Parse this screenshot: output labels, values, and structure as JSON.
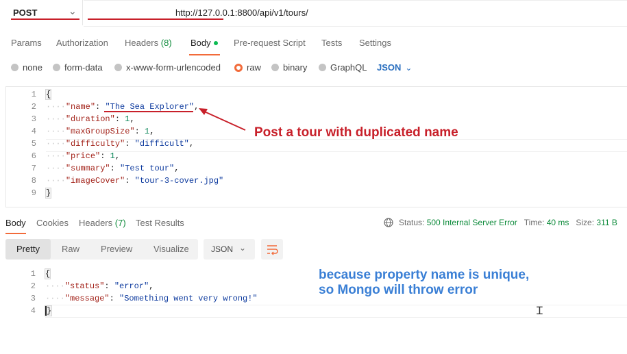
{
  "request": {
    "method": "POST",
    "url": "http://127.0.0.1:8800/api/v1/tours/"
  },
  "request_tabs": [
    {
      "label": "Params"
    },
    {
      "label": "Authorization"
    },
    {
      "label": "Headers",
      "count": "(8)"
    },
    {
      "label": "Body"
    },
    {
      "label": "Pre-request Script"
    },
    {
      "label": "Tests"
    },
    {
      "label": "Settings"
    }
  ],
  "body_types": {
    "none": "none",
    "form_data": "form-data",
    "urlencoded": "x-www-form-urlencoded",
    "raw": "raw",
    "binary": "binary",
    "graphql": "GraphQL",
    "format": "JSON",
    "selected": "raw"
  },
  "request_body": {
    "line_numbers": [
      "1",
      "2",
      "3",
      "4",
      "5",
      "6",
      "7",
      "8",
      "9"
    ],
    "open_brace": "{",
    "close_brace": "}",
    "fields": [
      {
        "key": "\"name\"",
        "value": "\"The Sea Explorer\"",
        "type": "string"
      },
      {
        "key": "\"duration\"",
        "value": "1",
        "type": "number"
      },
      {
        "key": "\"maxGroupSize\"",
        "value": "1",
        "type": "number"
      },
      {
        "key": "\"difficulty\"",
        "value": "\"difficult\"",
        "type": "string"
      },
      {
        "key": "\"price\"",
        "value": "1",
        "type": "number"
      },
      {
        "key": "\"summary\"",
        "value": "\"Test tour\"",
        "type": "string"
      },
      {
        "key": "\"imageCover\"",
        "value": "\"tour-3-cover.jpg\"",
        "type": "string"
      }
    ]
  },
  "annotations": {
    "request_note": "Post a tour with duplicated name",
    "response_note_line1": "because property name is unique,",
    "response_note_line2": "so Mongo will throw error",
    "request_color": "#c8202a",
    "response_color": "#3a7fd5"
  },
  "response_tabs": [
    {
      "label": "Body"
    },
    {
      "label": "Cookies"
    },
    {
      "label": "Headers",
      "count": "(7)"
    },
    {
      "label": "Test Results"
    }
  ],
  "response_status": {
    "status_label": "Status:",
    "status_value": "500 Internal Server Error",
    "time_label": "Time:",
    "time_value": "40 ms",
    "size_label": "Size:",
    "size_value": "311 B"
  },
  "response_view": {
    "modes": [
      "Pretty",
      "Raw",
      "Preview",
      "Visualize"
    ],
    "format": "JSON"
  },
  "response_body": {
    "line_numbers": [
      "1",
      "2",
      "3",
      "4"
    ],
    "open_brace": "{",
    "close_brace": "}",
    "fields": [
      {
        "key": "\"status\"",
        "value": "\"error\""
      },
      {
        "key": "\"message\"",
        "value": "\"Something went very wrong!\""
      }
    ]
  },
  "colors": {
    "accent": "#f26b3a",
    "status_green": "#0c8a3a",
    "link_blue": "#2a6fbf"
  }
}
